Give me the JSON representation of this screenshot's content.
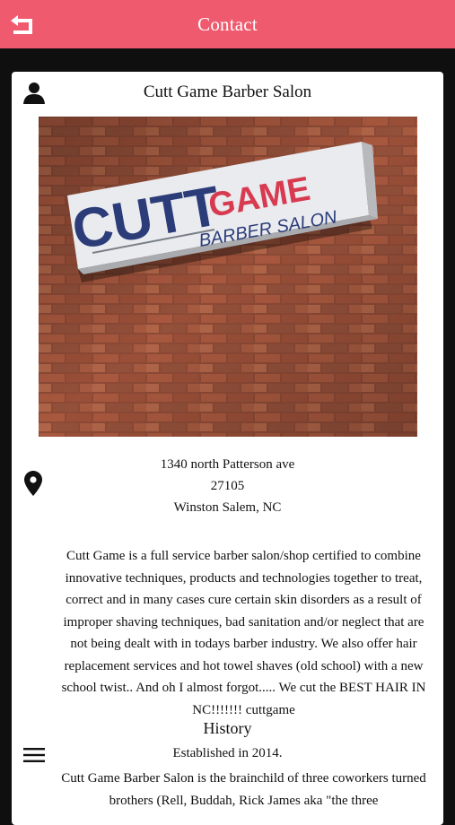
{
  "header": {
    "title": "Contact",
    "back_icon": "back-arrow-icon",
    "background_color": "#ef5a6f"
  },
  "profile": {
    "icon": "person-icon",
    "name": "Cutt Game Barber Salon"
  },
  "photo": {
    "sign_line1": "CUTT",
    "sign_line2": "GAME",
    "sign_line3": "BARBER SALON"
  },
  "address": {
    "icon": "map-pin-icon",
    "street": "1340 north Patterson ave",
    "zip": "27105",
    "city_state": "Winston Salem, NC"
  },
  "about": {
    "text": "Cutt Game is a full service barber salon/shop certified to combine  innovative techniques, products and technologies together to treat, correct and in many cases cure certain skin disorders as a result of improper shaving techniques, bad sanitation and/or neglect that are not being dealt with in todays barber industry. We also offer hair replacement services and hot towel shaves (old school) with a new school twist.. And oh I almost forgot..... We cut the  BEST HAIR IN NC!!!!!!! cuttgame"
  },
  "history": {
    "menu_icon": "menu-icon",
    "title": "History",
    "established": "Established in 2014.",
    "text": "Cutt Game Barber Salon is the brainchild of three coworkers turned brothers (Rell, Buddah, Rick James aka \"the three"
  }
}
